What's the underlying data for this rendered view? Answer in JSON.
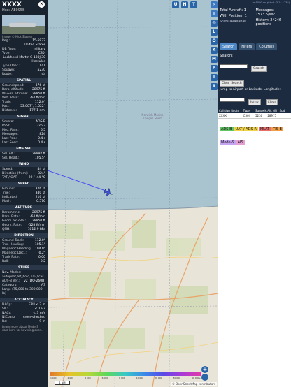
{
  "aircraft": {
    "callsign": "XXXX",
    "hex_line": "Hex: AE095B",
    "photo_caption": "Image © Nick Slasser",
    "info": [
      {
        "k": "Reg.:",
        "v": "15-5932"
      },
      {
        "k": "",
        "v": "United States"
      },
      {
        "k": "DB flags:",
        "v": "military"
      },
      {
        "k": "Type:",
        "v": "C30J"
      },
      {
        "k": "",
        "v": "Lockheed Martin C-130J-30 Hercules"
      },
      {
        "k": "Type Desc.:",
        "v": "L4T"
      },
      {
        "k": "Squawk:",
        "v": "5230"
      },
      {
        "k": "Route:",
        "v": "n/a"
      }
    ]
  },
  "sections": [
    {
      "title": "SPATIAL",
      "rows": [
        {
          "k": "Groundspeed:",
          "v": "376 kt"
        },
        {
          "k": "Baro. altitude:",
          "v": "28975 ft"
        },
        {
          "k": "WGS84 altitude:",
          "v": "28950 ft"
        },
        {
          "k": "Vert. Rate:",
          "v": "-64 ft/min"
        },
        {
          "k": "Track:",
          "v": "112.0°"
        },
        {
          "k": "Pos.:",
          "v": "53.007°, 1.022°"
        },
        {
          "k": "Distance:",
          "v": "177.1 nmi"
        }
      ]
    },
    {
      "title": "SIGNAL",
      "rows": [
        {
          "k": "Source:",
          "v": "ADS-B"
        },
        {
          "k": "RSSI:",
          "v": "-26.3"
        },
        {
          "k": "Msg. Rate:",
          "v": "6.5"
        },
        {
          "k": "Messages:",
          "v": "824"
        },
        {
          "k": "",
          "v": ""
        },
        {
          "k": "Last Pos.:",
          "v": "0.4 s"
        },
        {
          "k": "Last Seen:",
          "v": "0.4 s"
        }
      ]
    },
    {
      "title": "FMS SEL",
      "rows": [
        {
          "k": "Sel. Alt.:",
          "v": "28992 ft"
        },
        {
          "k": "Sel. Head.:",
          "v": "105.5°"
        }
      ]
    },
    {
      "title": "WIND",
      "rows": [
        {
          "k": "Speed:",
          "v": "44 kt"
        },
        {
          "k": "Direction (from):",
          "v": "324°"
        },
        {
          "k": "TAT / OAT:",
          "v": "-29 / -44 °C"
        }
      ]
    },
    {
      "title": "SPEED",
      "rows": [
        {
          "k": "Ground:",
          "v": "376 kt"
        },
        {
          "k": "True:",
          "v": "340 kt"
        },
        {
          "k": "Indicated:",
          "v": "216 kt"
        },
        {
          "k": "Mach:",
          "v": "0.576"
        }
      ]
    },
    {
      "title": "ALTITUDE",
      "rows": [
        {
          "k": "Barometric:",
          "v": "28975 ft"
        },
        {
          "k": "Baro. Rate:",
          "v": "-64 ft/min"
        },
        {
          "k": "Geom. WGS84:",
          "v": "28950 ft"
        },
        {
          "k": "Geom. Rate:",
          "v": "-128 ft/min"
        },
        {
          "k": "QNH:",
          "v": "1012.9 hPa"
        }
      ]
    },
    {
      "title": "DIRECTION",
      "rows": [
        {
          "k": "Ground Track:",
          "v": "112.0°"
        },
        {
          "k": "True Heading:",
          "v": "105.1°"
        },
        {
          "k": "Magnetic Heading:",
          "v": "104.9°"
        },
        {
          "k": "Magnetic Decl.:",
          "v": "-0.2°"
        },
        {
          "k": "Track Rate:",
          "v": "0.00"
        },
        {
          "k": "Roll:",
          "v": "0.2"
        }
      ]
    },
    {
      "title": "STUFF",
      "rows": [
        {
          "k": "Nav. Modes:",
          "v": ""
        },
        {
          "k": "autopilot,alt_hold,nav,tcas",
          "v": ""
        },
        {
          "k": "ADS-B Ver.:",
          "v": "v2 (DO-260B)"
        },
        {
          "k": "Category:",
          "v": "A3"
        },
        {
          "k": "Large (75,000 to 300,000 lb)",
          "v": ""
        }
      ]
    },
    {
      "title": "ACCURACY",
      "rows": [
        {
          "k": "NACp:",
          "v": "EPU < 3 m"
        },
        {
          "k": "SIL:",
          "v": "≤ 1e-7"
        },
        {
          "k": "NACv:",
          "v": "< 3 m/s"
        },
        {
          "k": "NICbaro:",
          "v": "cross-checked"
        },
        {
          "k": "Rc:",
          "v": "9 m"
        }
      ]
    }
  ],
  "footer_text": "Learn more about Mode-S data here for hovering over...",
  "map": {
    "top_buttons": [
      "U",
      "H",
      "T"
    ],
    "side_buttons": [
      "L",
      "O",
      "K",
      "M",
      "P",
      "I",
      "R"
    ],
    "place_label": "Norwich Marine Ledges Shelf",
    "scale_label": "1 NM",
    "attribution": "© OpenStreetMap contributors",
    "zoom_in": "+",
    "zoom_out": "−",
    "altitude_ticks": [
      "1 000",
      "2 000",
      "4 000",
      "6 000",
      "8 000",
      "10 000",
      "20 000",
      "30 000",
      "40 000+"
    ]
  },
  "sidebar": {
    "version": "tar1090 on github (3.14.1738)",
    "total_aircraft": "Total Aircraft: 1",
    "with_position": "With Position: 1",
    "stats_label": "Stats available",
    "messages": "Messages: 1573.5/sec",
    "history": "History: 24246 positions",
    "tabs": [
      "Search",
      "Filters",
      "Columns"
    ],
    "search_label": "Search:",
    "search_button": "Search",
    "clear_search": "Clear Search",
    "jump_label": "Jump to Airport or Latitude, Longitude:",
    "jump_button": "Jump",
    "clear_button": "Clear",
    "columns": [
      "Callsign",
      "Route",
      "Type",
      "Squawk",
      "Alt. (ft)",
      "Spd"
    ],
    "row": [
      "XXXX",
      "",
      "C30J",
      "5230",
      "28975",
      ""
    ],
    "legend": [
      "ADS-B",
      "UAT / ADS-R",
      "MLAT",
      "TIS-B",
      "Mode-S",
      "AIS"
    ]
  },
  "colors": {
    "panel_bg": "#1a2330",
    "button_blue": "#2a65a8",
    "track_line": "#4a4ef0",
    "aircraft": "#3d57d8",
    "legend": [
      "#62c462",
      "#f0d34c",
      "#e86e6e",
      "#ef9f4a",
      "#c5a4f2",
      "#e6a1d4"
    ]
  }
}
